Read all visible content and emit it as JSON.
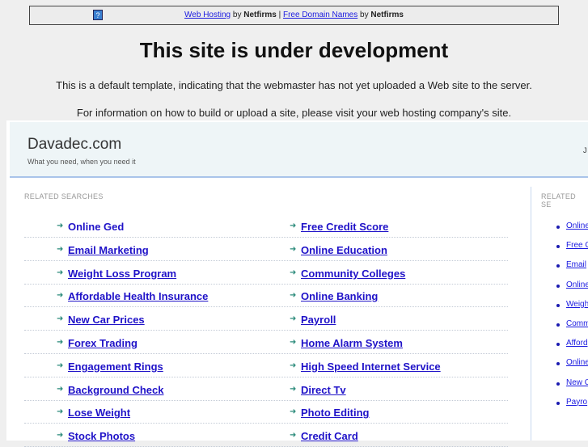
{
  "banner": {
    "link1": "Web Hosting",
    "by1": " by ",
    "brand1": "Netfirms",
    "sep": " | ",
    "link2": "Free Domain Names",
    "by2": " by ",
    "brand2": "Netfirms"
  },
  "title": "This site is under development",
  "para1": "This is a default template, indicating that the webmaster has not yet uploaded a Web site to the server.",
  "para2": "For information on how to build or upload a site, please visit your web hosting company's site.",
  "site": {
    "name": "Davadec.com",
    "tagline": "What you need, when you need it",
    "right_char": "J"
  },
  "main": {
    "heading": "RELATED SEARCHES",
    "col1": [
      "Online Ged",
      "Email Marketing",
      "Weight Loss Program",
      "Affordable Health Insurance",
      "New Car Prices",
      "Forex Trading",
      "Engagement Rings",
      "Background Check",
      "Lose Weight",
      "Stock Photos"
    ],
    "col2": [
      "Free Credit Score",
      "Online Education",
      "Community Colleges",
      "Online Banking",
      "Payroll",
      "Home Alarm System",
      "High Speed Internet Service",
      "Direct Tv",
      "Photo Editing",
      "Credit Card"
    ]
  },
  "sidebar": {
    "heading": "RELATED SE",
    "items": [
      "Online",
      "Free C",
      "Email",
      "Online",
      "Weigh",
      "Comm",
      "Afford",
      "Online",
      "New C",
      "Payro"
    ]
  }
}
